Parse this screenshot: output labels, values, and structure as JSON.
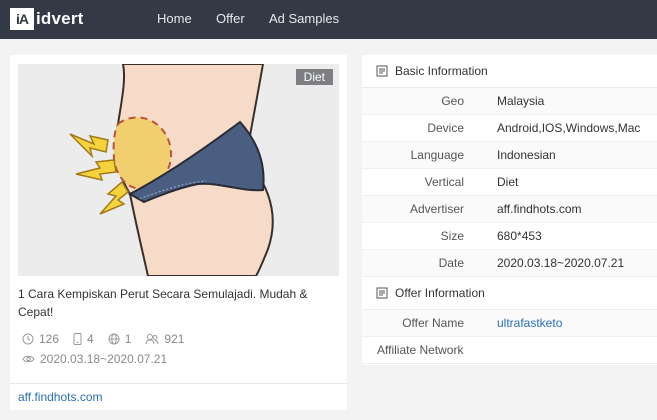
{
  "nav": {
    "logo_mark": "iA",
    "logo_text": "idvert",
    "items": [
      {
        "label": "Home"
      },
      {
        "label": "Offer"
      },
      {
        "label": "Ad Samples"
      }
    ]
  },
  "ad": {
    "tag": "Diet",
    "title": "1 Cara Kempiskan Perut Secara Semulajadi. Mudah & Cepat!",
    "stats": {
      "time": "126",
      "devices": "4",
      "geo": "1",
      "users": "921"
    },
    "date_range": "2020.03.18~2020.07.21",
    "advertiser": "aff.findhots.com"
  },
  "basic_info": {
    "heading": "Basic Information",
    "rows": [
      {
        "label": "Geo",
        "value": "Malaysia"
      },
      {
        "label": "Device",
        "value": "Android,IOS,Windows,Mac"
      },
      {
        "label": "Language",
        "value": "Indonesian"
      },
      {
        "label": "Vertical",
        "value": "Diet"
      },
      {
        "label": "Advertiser",
        "value": "aff.findhots.com"
      },
      {
        "label": "Size",
        "value": "680*453"
      },
      {
        "label": "Date",
        "value": "2020.03.18~2020.07.21"
      }
    ]
  },
  "offer_info": {
    "heading": "Offer Information",
    "rows": [
      {
        "label": "Offer Name",
        "value": "ultrafastketo"
      },
      {
        "label": "Affiliate Network",
        "value": ""
      }
    ]
  },
  "colors": {
    "nav_bg": "#333a45",
    "link": "#2a6fb5",
    "tag_bg": "#7d7f82"
  }
}
